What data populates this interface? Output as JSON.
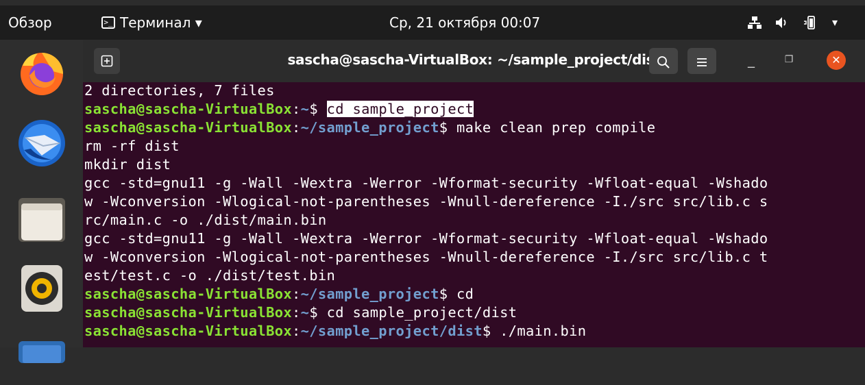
{
  "topbar": {
    "activities": "Обзор",
    "app_menu": "Терминал ▾",
    "clock": "Ср, 21 октября  00:07",
    "tray": {
      "network_icon": "network-wired-icon",
      "volume_icon": "volume-icon",
      "battery_icon": "battery-icon",
      "menu_caret": "▾"
    }
  },
  "dock": {
    "apps": [
      "firefox-icon",
      "thunderbird-icon",
      "files-icon",
      "rhythmbox-icon",
      "software-icon"
    ]
  },
  "window": {
    "title": "sascha@sascha-VirtualBox: ~/sample_project/dist",
    "new_tab_glyph": "+",
    "min_glyph": "_",
    "max_glyph": "❐",
    "close_glyph": "✕"
  },
  "terminal": {
    "lines": [
      {
        "out": "2 directories, 7 files"
      },
      {
        "user": "sascha@sascha-VirtualBox",
        "sep": ":",
        "path": "~",
        "prompt": "$ ",
        "cmd": "cd sample_project",
        "selected": true
      },
      {
        "user": "sascha@sascha-VirtualBox",
        "sep": ":",
        "path": "~/sample_project",
        "prompt": "$ ",
        "cmd": "make clean prep compile"
      },
      {
        "out": "rm -rf dist"
      },
      {
        "out": "mkdir dist"
      },
      {
        "out": "gcc -std=gnu11 -g -Wall -Wextra -Werror -Wformat-security -Wfloat-equal -Wshado"
      },
      {
        "out": "w -Wconversion -Wlogical-not-parentheses -Wnull-dereference -I./src src/lib.c s"
      },
      {
        "out": "rc/main.c -o ./dist/main.bin"
      },
      {
        "out": "gcc -std=gnu11 -g -Wall -Wextra -Werror -Wformat-security -Wfloat-equal -Wshado"
      },
      {
        "out": "w -Wconversion -Wlogical-not-parentheses -Wnull-dereference -I./src src/lib.c t"
      },
      {
        "out": "est/test.c -o ./dist/test.bin"
      },
      {
        "user": "sascha@sascha-VirtualBox",
        "sep": ":",
        "path": "~/sample_project",
        "prompt": "$ ",
        "cmd": "cd"
      },
      {
        "user": "sascha@sascha-VirtualBox",
        "sep": ":",
        "path": "~",
        "prompt": "$ ",
        "cmd": "cd sample_project/dist"
      },
      {
        "user": "sascha@sascha-VirtualBox",
        "sep": ":",
        "path": "~/sample_project/dist",
        "prompt": "$ ",
        "cmd": "./main.bin"
      }
    ]
  },
  "colors": {
    "terminal_bg": "#300a24",
    "prompt_user": "#8ae234",
    "prompt_path": "#729fcf",
    "close_button": "#e95420"
  }
}
